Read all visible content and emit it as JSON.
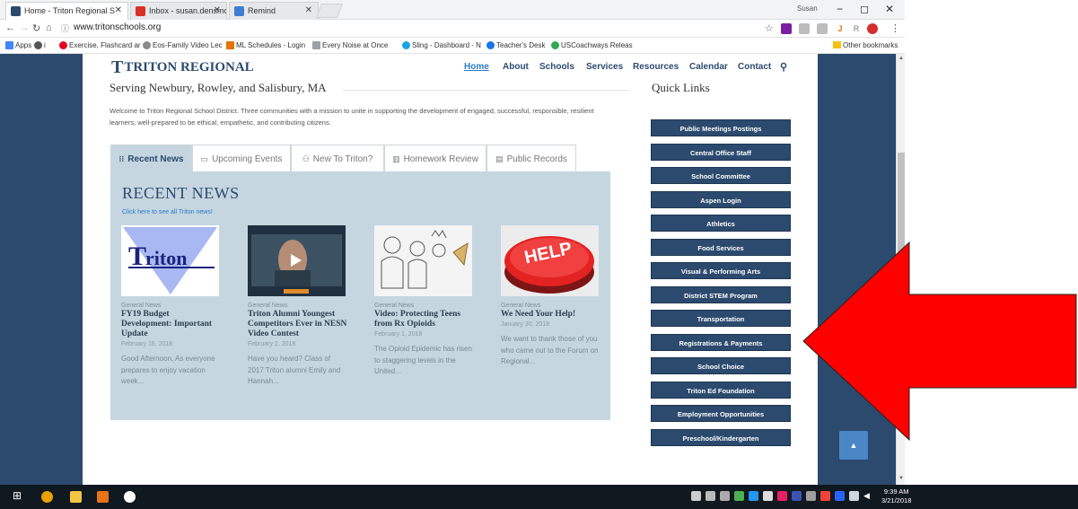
{
  "browser": {
    "tabs": [
      {
        "title": "Home - Triton Regional S",
        "icon_color": "#2c4a6e"
      },
      {
        "title": "Inbox - susan.densmore@",
        "icon_color": "#d93025"
      },
      {
        "title": "Remind",
        "icon_color": "#3d7ed0"
      }
    ],
    "profile_name": "Susan",
    "url": "www.tritonschools.org",
    "bookmarks": [
      {
        "label": "Apps",
        "color": "#4285f4"
      },
      {
        "label": "i",
        "color": "#555555"
      },
      {
        "label": "Exercise, Flashcard ar",
        "color": "#e60023"
      },
      {
        "label": "Eos-Family Video Lec",
        "color": "#8a8a8a"
      },
      {
        "label": "ML Schedules - Login",
        "color": "#e37400"
      },
      {
        "label": "Every Noise at Once",
        "color": "#9aa0a6"
      },
      {
        "label": "Sling - Dashboard - N",
        "color": "#1aa3e8"
      },
      {
        "label": "Teacher's Desk",
        "color": "#1a73e8"
      },
      {
        "label": "USCoachways Releas",
        "color": "#34a853"
      }
    ],
    "other_bookmarks": "Other bookmarks"
  },
  "site": {
    "logo": "TRITON REGIONAL",
    "nav": [
      "Home",
      "About",
      "Schools",
      "Services",
      "Resources",
      "Calendar",
      "Contact"
    ],
    "tagline": "Serving Newbury, Rowley, and Salisbury, MA",
    "intro": "Welcome to Triton Regional School District. Three communities with a mission to unite in supporting the development of engaged, successful, responsible, resilient learners; well-prepared to be ethical, empathetic, and contributing citizens.",
    "tabs": [
      "Recent News",
      "Upcoming Events",
      "New To Triton?",
      "Homework Review",
      "Public Records"
    ],
    "recent_heading": "RECENT NEWS",
    "see_all": "Click here to see all Triton news!",
    "news": [
      {
        "category": "General News",
        "title": "FY19 Budget Development: Important Update",
        "date": "February 16, 2018",
        "excerpt": "Good Afternoon, As everyone prepares to enjoy vacation week..."
      },
      {
        "category": "General News",
        "title": "Triton Alumni Youngest Competitors Ever in NESN Video Contest",
        "date": "February 2, 2018",
        "excerpt": "Have you heard? Class of 2017 Triton alumni Emily and Hannah..."
      },
      {
        "category": "General News",
        "title": "Video: Protecting Teens from Rx Opioids",
        "date": "February 1, 2018",
        "excerpt": "The Opioid Epidemic has risen to staggering levels in the United..."
      },
      {
        "category": "General News",
        "title": "We Need Your Help!",
        "date": "January 30, 2018",
        "excerpt": "We want to thank those of you who came out to the Forum on Regional..."
      }
    ],
    "help_sign": "HELP",
    "quick_links_title": "Quick Links",
    "quick_links": [
      "Public Meetings Postings",
      "Central Office Staff",
      "School Committee",
      "Aspen Login",
      "Athletics",
      "Food Services",
      "Visual & Performing Arts",
      "District STEM Program",
      "Transportation",
      "Registrations & Payments",
      "School Choice",
      "Triton Ed Foundation",
      "Employment Opportunities",
      "Preschool/Kindergarten"
    ]
  },
  "taskbar": {
    "time": "9:39 AM",
    "date": "3/21/2018"
  },
  "colors": {
    "brand_navy": "#2c4a6e",
    "panel_blue": "#c5d6e0",
    "arrow_red": "#ff0000"
  }
}
